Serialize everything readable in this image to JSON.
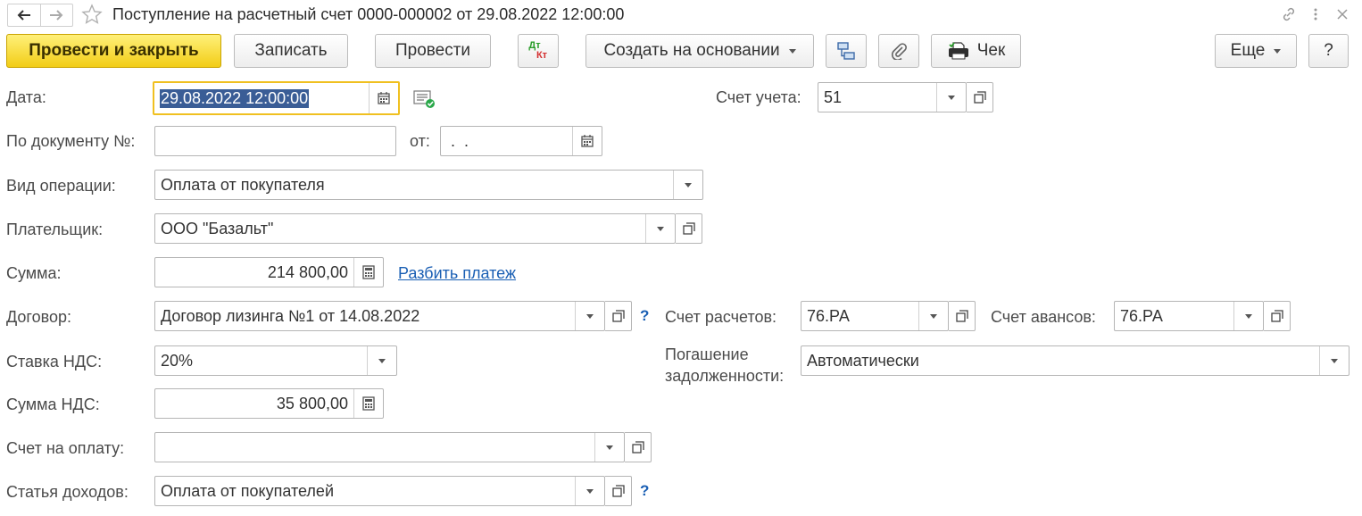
{
  "window": {
    "title": "Поступление на расчетный счет 0000-000002 от 29.08.2022 12:00:00"
  },
  "toolbar": {
    "post_close": "Провести и закрыть",
    "save": "Записать",
    "post": "Провести",
    "dtkt_dt": "Дт",
    "dtkt_kt": "Кт",
    "create_based": "Создать на основании",
    "check": "Чек",
    "more": "Еще",
    "help": "?"
  },
  "form": {
    "date_label": "Дата:",
    "date_value": "29.08.2022 12:00:00",
    "account_label": "Счет учета:",
    "account_value": "51",
    "docnum_label": "По документу №:",
    "docnum_value": "",
    "from_label": "от:",
    "from_value": " .  .",
    "op_label": "Вид операции:",
    "op_value": "Оплата от покупателя",
    "payer_label": "Плательщик:",
    "payer_value": "ООО \"Базальт\"",
    "sum_label": "Сумма:",
    "sum_value": "214 800,00",
    "split_link": "Разбить платеж",
    "contract_label": "Договор:",
    "contract_value": "Договор лизинга №1 от 14.08.2022",
    "settle_label": "Счет расчетов:",
    "settle_value": "76.РА",
    "advance_label": "Счет авансов:",
    "advance_value": "76.РА",
    "vat_rate_label": "Ставка НДС:",
    "vat_rate_value": "20%",
    "repay_label_1": "Погашение",
    "repay_label_2": "задолженности:",
    "repay_value": "Автоматически",
    "vat_sum_label": "Сумма НДС:",
    "vat_sum_value": "35 800,00",
    "invoice_label": "Счет на оплату:",
    "invoice_value": "",
    "income_label": "Статья доходов:",
    "income_value": "Оплата от покупателей",
    "q1": "?",
    "q2": "?"
  },
  "colors": {
    "primary_button": "#f2cd16",
    "link": "#1a5fb4",
    "focus_border": "#f0c020",
    "selection": "#3a5d96"
  }
}
